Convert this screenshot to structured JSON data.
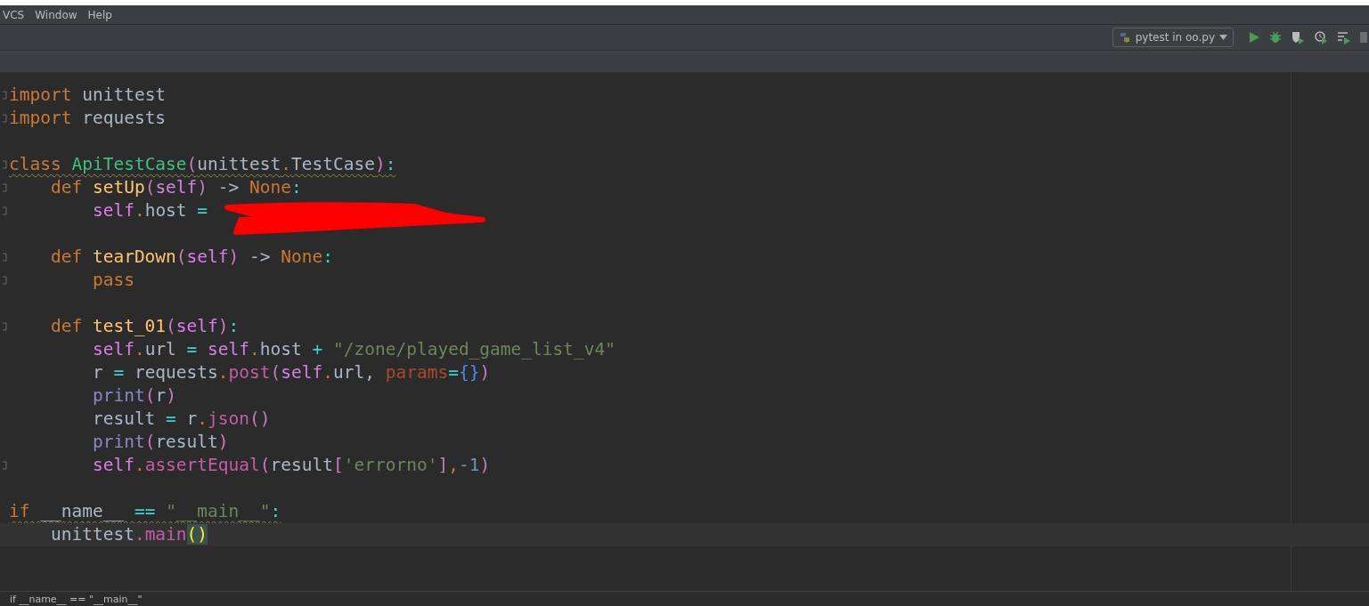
{
  "menu": [
    {
      "label": "VCS"
    },
    {
      "label": "Window"
    },
    {
      "label": "Help"
    }
  ],
  "toolbar": {
    "run_config": "pytest in oo.py"
  },
  "editor": {
    "blocks": [
      {
        "lines": [
          {
            "fold": true,
            "warning": false,
            "current": false,
            "tokens": [
              {
                "kind": "keyword",
                "text": "import "
              },
              {
                "kind": "plain",
                "text": "unittest"
              }
            ]
          },
          {
            "fold": true,
            "warning": false,
            "current": false,
            "tokens": [
              {
                "kind": "keyword",
                "text": "import "
              },
              {
                "kind": "plain",
                "text": "requests"
              }
            ]
          }
        ]
      },
      {
        "lines": [
          {
            "fold": true,
            "warning": true,
            "current": false,
            "tokens": [
              {
                "kind": "keyword",
                "text": "class "
              },
              {
                "kind": "classname",
                "text": "ApiTestCase"
              },
              {
                "kind": "paren",
                "text": "("
              },
              {
                "kind": "plain",
                "text": "unittest"
              },
              {
                "kind": "dot",
                "text": "."
              },
              {
                "kind": "plain",
                "text": "TestCase"
              },
              {
                "kind": "paren",
                "text": ")"
              },
              {
                "kind": "op",
                "text": ":"
              }
            ]
          },
          {
            "fold": true,
            "warning": false,
            "current": false,
            "tokens": [
              {
                "kind": "keyword",
                "text": "    def "
              },
              {
                "kind": "funcdef",
                "text": "setUp"
              },
              {
                "kind": "paren",
                "text": "("
              },
              {
                "kind": "self",
                "text": "self"
              },
              {
                "kind": "paren",
                "text": ")"
              },
              {
                "kind": "plain",
                "text": " -> "
              },
              {
                "kind": "keyword",
                "text": "None"
              },
              {
                "kind": "op",
                "text": ":"
              }
            ]
          },
          {
            "fold": true,
            "warning": false,
            "current": false,
            "tokens": [
              {
                "kind": "self",
                "text": "        self"
              },
              {
                "kind": "dot",
                "text": "."
              },
              {
                "kind": "plain",
                "text": "host "
              },
              {
                "kind": "op",
                "text": "="
              }
            ]
          }
        ]
      },
      {
        "lines": [
          {
            "fold": true,
            "warning": false,
            "current": false,
            "tokens": [
              {
                "kind": "keyword",
                "text": "    def "
              },
              {
                "kind": "funcdef",
                "text": "tearDown"
              },
              {
                "kind": "paren",
                "text": "("
              },
              {
                "kind": "self",
                "text": "self"
              },
              {
                "kind": "paren",
                "text": ")"
              },
              {
                "kind": "plain",
                "text": " -> "
              },
              {
                "kind": "keyword",
                "text": "None"
              },
              {
                "kind": "op",
                "text": ":"
              }
            ]
          },
          {
            "fold": true,
            "warning": false,
            "current": false,
            "tokens": [
              {
                "kind": "keyword",
                "text": "        pass"
              }
            ]
          }
        ]
      },
      {
        "lines": [
          {
            "fold": true,
            "warning": false,
            "current": false,
            "tokens": [
              {
                "kind": "keyword",
                "text": "    def "
              },
              {
                "kind": "funcdef",
                "text": "test_01"
              },
              {
                "kind": "paren",
                "text": "("
              },
              {
                "kind": "self",
                "text": "self"
              },
              {
                "kind": "paren",
                "text": ")"
              },
              {
                "kind": "op",
                "text": ":"
              }
            ]
          },
          {
            "fold": false,
            "warning": false,
            "current": false,
            "tokens": [
              {
                "kind": "self",
                "text": "        self"
              },
              {
                "kind": "dot",
                "text": "."
              },
              {
                "kind": "plain",
                "text": "url "
              },
              {
                "kind": "op",
                "text": "= "
              },
              {
                "kind": "self",
                "text": "self"
              },
              {
                "kind": "dot",
                "text": "."
              },
              {
                "kind": "plain",
                "text": "host "
              },
              {
                "kind": "op",
                "text": "+ "
              },
              {
                "kind": "string",
                "text": "\"/zone/played_game_list_v4\""
              }
            ]
          },
          {
            "fold": false,
            "warning": false,
            "current": false,
            "tokens": [
              {
                "kind": "plain",
                "text": "        r "
              },
              {
                "kind": "op",
                "text": "= "
              },
              {
                "kind": "plain",
                "text": "requests"
              },
              {
                "kind": "dot",
                "text": "."
              },
              {
                "kind": "method",
                "text": "post"
              },
              {
                "kind": "paren",
                "text": "("
              },
              {
                "kind": "self",
                "text": "self"
              },
              {
                "kind": "dot",
                "text": "."
              },
              {
                "kind": "plain",
                "text": "url, "
              },
              {
                "kind": "param",
                "text": "params"
              },
              {
                "kind": "op",
                "text": "="
              },
              {
                "kind": "brace",
                "text": "{}"
              },
              {
                "kind": "paren",
                "text": ")"
              }
            ]
          },
          {
            "fold": false,
            "warning": false,
            "current": false,
            "tokens": [
              {
                "kind": "builtin",
                "text": "        print"
              },
              {
                "kind": "paren",
                "text": "("
              },
              {
                "kind": "plain",
                "text": "r"
              },
              {
                "kind": "paren",
                "text": ")"
              }
            ]
          },
          {
            "fold": false,
            "warning": false,
            "current": false,
            "tokens": [
              {
                "kind": "plain",
                "text": "        result "
              },
              {
                "kind": "op",
                "text": "= "
              },
              {
                "kind": "plain",
                "text": "r"
              },
              {
                "kind": "dot",
                "text": "."
              },
              {
                "kind": "method",
                "text": "json"
              },
              {
                "kind": "paren",
                "text": "()"
              }
            ]
          },
          {
            "fold": false,
            "warning": false,
            "current": false,
            "tokens": [
              {
                "kind": "builtin",
                "text": "        print"
              },
              {
                "kind": "paren",
                "text": "("
              },
              {
                "kind": "plain",
                "text": "result"
              },
              {
                "kind": "paren",
                "text": ")"
              }
            ]
          },
          {
            "fold": true,
            "warning": false,
            "current": false,
            "tokens": [
              {
                "kind": "self",
                "text": "        self"
              },
              {
                "kind": "dot",
                "text": "."
              },
              {
                "kind": "method",
                "text": "assertEqual"
              },
              {
                "kind": "paren",
                "text": "("
              },
              {
                "kind": "plain",
                "text": "result"
              },
              {
                "kind": "paren",
                "text": "["
              },
              {
                "kind": "string",
                "text": "'errorno'"
              },
              {
                "kind": "paren",
                "text": "]"
              },
              {
                "kind": "dot",
                "text": ","
              },
              {
                "kind": "number",
                "text": "-1"
              },
              {
                "kind": "paren",
                "text": ")"
              }
            ]
          }
        ]
      },
      {
        "lines": [
          {
            "fold": false,
            "warning": true,
            "current": false,
            "tokens": [
              {
                "kind": "keyword",
                "text": "if "
              },
              {
                "kind": "plain",
                "text": "__name__ "
              },
              {
                "kind": "op",
                "text": "== "
              },
              {
                "kind": "string",
                "text": "\"__main__\""
              },
              {
                "kind": "op",
                "text": ":"
              }
            ]
          },
          {
            "fold": false,
            "warning": false,
            "current": true,
            "tokens": [
              {
                "kind": "plain",
                "text": "    unittest"
              },
              {
                "kind": "method",
                "text": ".main"
              },
              {
                "kind": "matchparen",
                "text": "()"
              }
            ]
          }
        ]
      }
    ]
  },
  "breadcrumb": "if __name__ == \"__main__\""
}
